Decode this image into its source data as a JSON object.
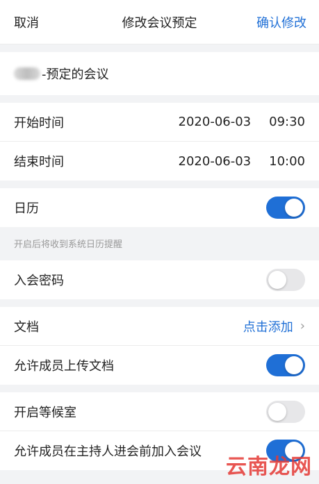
{
  "header": {
    "cancel_label": "取消",
    "title": "修改会议预定",
    "confirm_label": "确认修改"
  },
  "topic": {
    "value": "-预定的会议"
  },
  "time": {
    "start_label": "开始时间",
    "start_date": "2020-06-03",
    "start_time": "09:30",
    "end_label": "结束时间",
    "end_date": "2020-06-03",
    "end_time": "10:00"
  },
  "calendar": {
    "label": "日历",
    "enabled": true,
    "hint": "开启后将收到系统日历提醒"
  },
  "password": {
    "label": "入会密码",
    "enabled": false
  },
  "documents": {
    "label": "文档",
    "add_label": "点击添加",
    "allow_upload_label": "允许成员上传文档",
    "allow_upload_enabled": true
  },
  "waiting_room": {
    "label": "开启等候室",
    "enabled": false,
    "join_before_host_label": "允许成员在主持人进会前加入会议",
    "join_before_host_enabled": true
  },
  "watermark": {
    "text": "云南龙网"
  },
  "colors": {
    "accent": "#1f6fd6",
    "toggle_off": "#e7e7e9",
    "background": "#f2f3f5"
  }
}
